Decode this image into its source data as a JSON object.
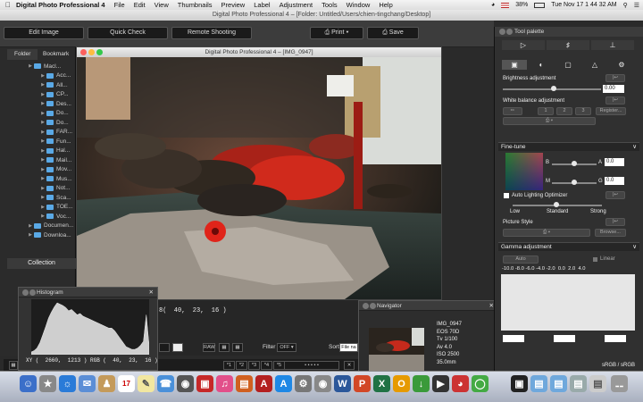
{
  "menubar": {
    "app": "Digital Photo Professional 4",
    "items": [
      "File",
      "Edit",
      "View",
      "Thumbnails",
      "Preview",
      "Label",
      "Adjustment",
      "Tools",
      "Window",
      "Help"
    ],
    "battery": "38%",
    "clock": "Tue Nov 17  1 44 32 AM"
  },
  "main_window": {
    "title": "Digital Photo Professional 4 – [Folder: Untitled/Users/chien-tingchang/Desktop]"
  },
  "toolbar": {
    "edit_image": "Edit Image",
    "quick_check": "Quick Check",
    "remote_shooting": "Remote Shooting",
    "print": "Print",
    "save": "Save"
  },
  "left_panel": {
    "tabs": [
      "Folder",
      "Bookmark"
    ],
    "tree": [
      {
        "label": "Macl...",
        "level": 0
      },
      {
        "label": "Acc...",
        "level": 1
      },
      {
        "label": "All...",
        "level": 1
      },
      {
        "label": "CP...",
        "level": 1
      },
      {
        "label": "Des...",
        "level": 1
      },
      {
        "label": "Do...",
        "level": 1
      },
      {
        "label": "Do...",
        "level": 1
      },
      {
        "label": "FAR...",
        "level": 1
      },
      {
        "label": "Fun...",
        "level": 1
      },
      {
        "label": "Hal...",
        "level": 1
      },
      {
        "label": "Mail...",
        "level": 1
      },
      {
        "label": "Mov...",
        "level": 1
      },
      {
        "label": "Mus...",
        "level": 1
      },
      {
        "label": "Not...",
        "level": 1
      },
      {
        "label": "Sca...",
        "level": 1
      },
      {
        "label": "TOE...",
        "level": 1
      },
      {
        "label": "Voc...",
        "level": 1
      },
      {
        "label": "Documen...",
        "level": 0
      },
      {
        "label": "Downloa...",
        "level": 0
      }
    ],
    "collection": "Collection"
  },
  "image_window": {
    "title": "Digital Photo Professional 4 – [IMG_0947]"
  },
  "bottom_bar": {
    "coords": "8(  40,  23,  16 )",
    "filter_label": "Filter",
    "filter_value": "OFF",
    "sort_label": "Sort",
    "sort_value": "File na",
    "ratings": [
      "*1",
      "*2",
      "*3",
      "*4",
      "*5"
    ]
  },
  "histogram": {
    "title": "Histogram",
    "readout": "XY (  2660,  1213 ) RGB (  40,  23,  16 )",
    "readout2": "85   GG",
    "levels": [
      4,
      6,
      10,
      18,
      30,
      42,
      55,
      64,
      72,
      78,
      76,
      74,
      71,
      66,
      68,
      64,
      60,
      62,
      58,
      56,
      54,
      52,
      50,
      48,
      46,
      44,
      42,
      40,
      40,
      36,
      30,
      24,
      18,
      12,
      10,
      8,
      8,
      10,
      14,
      20,
      60,
      14
    ]
  },
  "navigator": {
    "title": "Navigator",
    "file": "IMG_0947",
    "camera": "EOS 70D",
    "tv": "Tv 1/100",
    "av": "Av 4.0",
    "iso": "ISO 2500",
    "focal": "35.0mm"
  },
  "tool_palette": {
    "title": "Tool palette",
    "brightness_label": "Brightness adjustment",
    "brightness_value": "0.00",
    "wb_label": "White balance adjustment",
    "wb_buttons": [
      "1",
      "2",
      "3"
    ],
    "register": "Register...",
    "finetune_label": "Fine-tune",
    "b_label": "B",
    "a_label": "A",
    "a_value": "0.0",
    "m_label": "M",
    "g_label": "G",
    "g_value": "0.0",
    "alo_label": "Auto Lighting Optimizer",
    "alo_levels": [
      "Low",
      "Standard",
      "Strong"
    ],
    "picture_style_label": "Picture Style",
    "browse": "Browse...",
    "gamma_label": "Gamma adjustment",
    "gamma_auto": "Auto",
    "gamma_linear": "Linear",
    "gamma_ticks": "-10.0 -8.0 -6.0 -4.0 -2.0  0.0  2.0  4.0",
    "color_space": "sRGB / sRGB"
  }
}
